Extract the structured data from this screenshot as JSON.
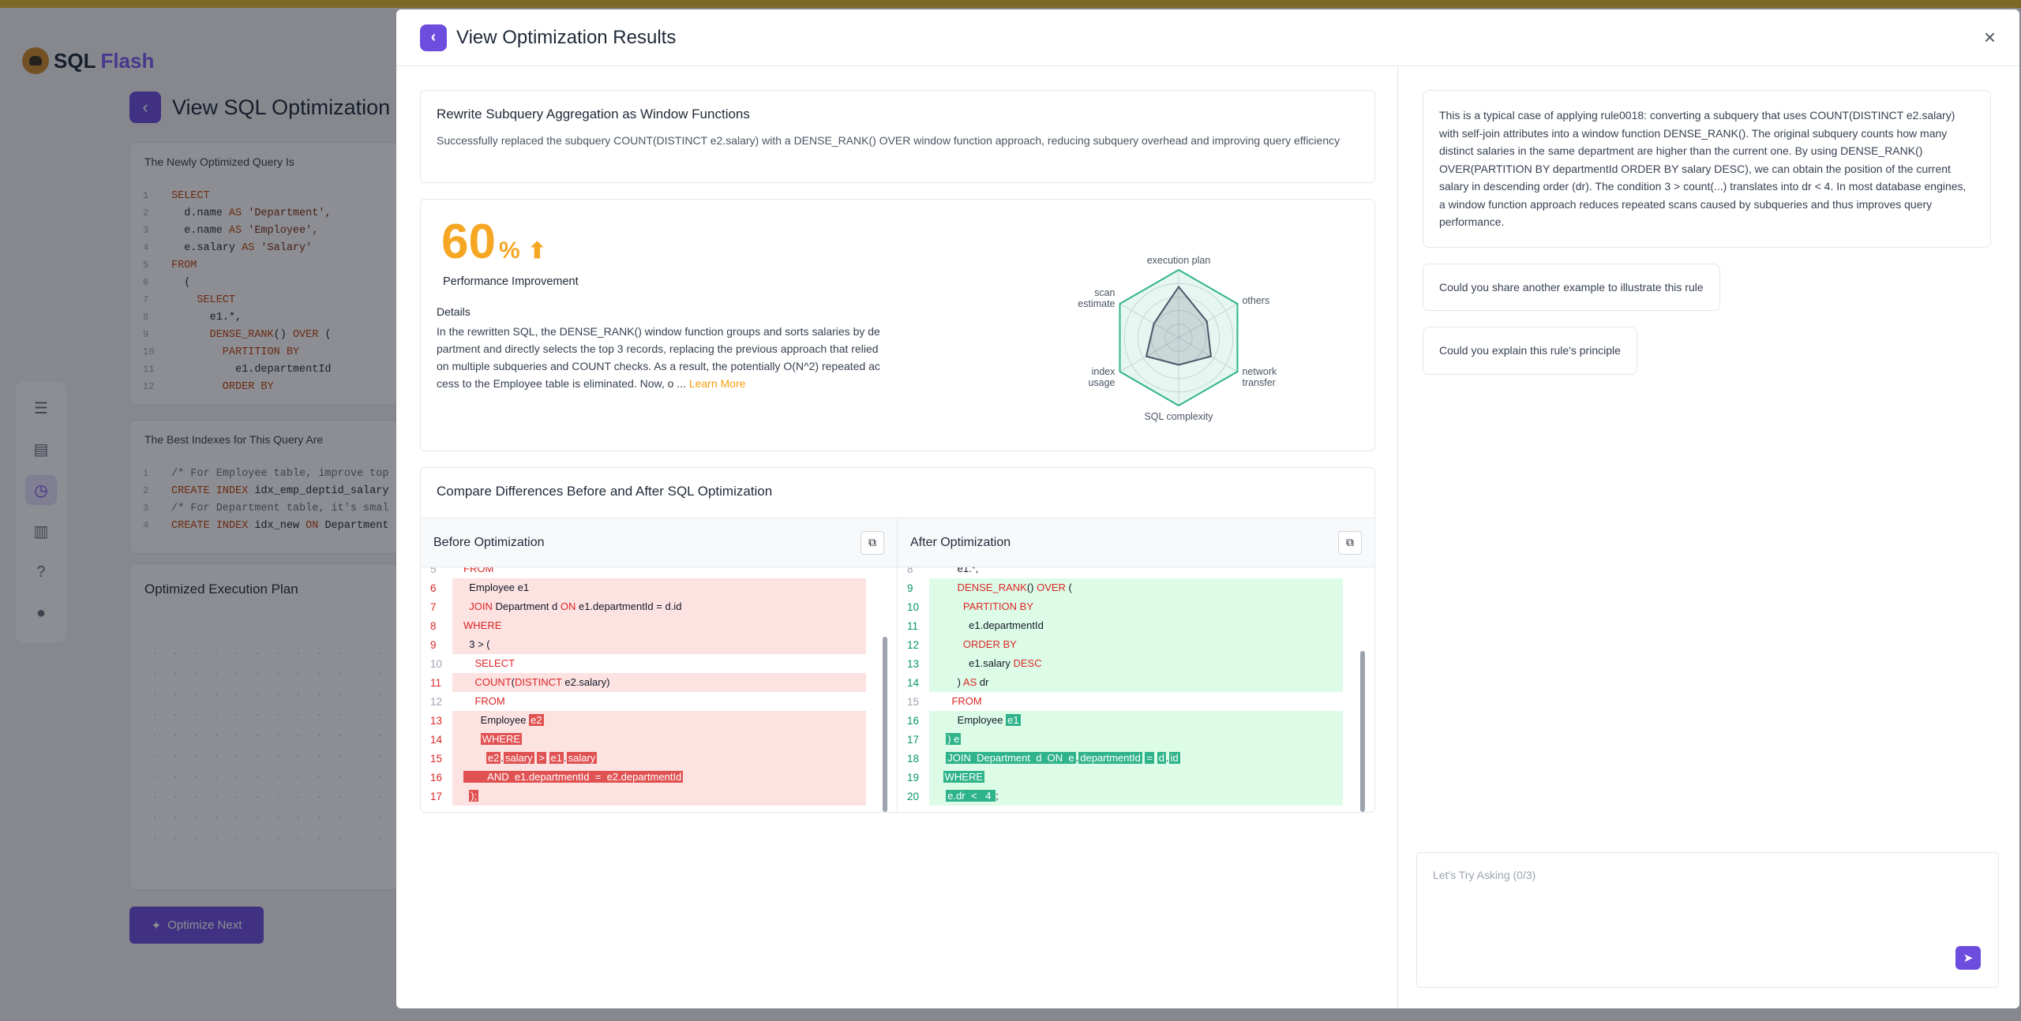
{
  "background": {
    "logo": {
      "sql": "SQL",
      "flash": "Flash"
    },
    "title": "View SQL Optimization Re",
    "optimized_query_title": "The Newly Optimized Query Is",
    "optimized_query_lines": [
      {
        "no": "1",
        "html_parts": [
          {
            "t": "SELECT",
            "c": "kw"
          }
        ]
      },
      {
        "no": "2",
        "html_parts": [
          {
            "t": "  d.name ",
            "c": ""
          },
          {
            "t": "AS",
            "c": "kw"
          },
          {
            "t": " 'Department',",
            "c": "str"
          }
        ]
      },
      {
        "no": "3",
        "html_parts": [
          {
            "t": "  e.name ",
            "c": ""
          },
          {
            "t": "AS",
            "c": "kw"
          },
          {
            "t": " 'Employee',",
            "c": "str"
          }
        ]
      },
      {
        "no": "4",
        "html_parts": [
          {
            "t": "  e.salary ",
            "c": ""
          },
          {
            "t": "AS",
            "c": "kw"
          },
          {
            "t": " 'Salary'",
            "c": "str"
          }
        ]
      },
      {
        "no": "5",
        "html_parts": [
          {
            "t": "FROM",
            "c": "kw"
          }
        ]
      },
      {
        "no": "6",
        "html_parts": [
          {
            "t": "  (",
            "c": ""
          }
        ]
      },
      {
        "no": "7",
        "html_parts": [
          {
            "t": "    SELECT",
            "c": "kw"
          }
        ]
      },
      {
        "no": "8",
        "html_parts": [
          {
            "t": "      e1.*,",
            "c": ""
          }
        ]
      },
      {
        "no": "9",
        "html_parts": [
          {
            "t": "      DENSE_RANK",
            "c": "kw"
          },
          {
            "t": "() ",
            "c": ""
          },
          {
            "t": "OVER",
            "c": "kw"
          },
          {
            "t": " (",
            "c": ""
          }
        ]
      },
      {
        "no": "10",
        "html_parts": [
          {
            "t": "        PARTITION BY",
            "c": "kw"
          }
        ]
      },
      {
        "no": "11",
        "html_parts": [
          {
            "t": "          e1.departmentId",
            "c": ""
          }
        ]
      },
      {
        "no": "12",
        "html_parts": [
          {
            "t": "        ORDER BY",
            "c": "kw"
          }
        ]
      }
    ],
    "indexes_title": "The Best Indexes for This Query Are",
    "index_lines": [
      {
        "no": "1",
        "html_parts": [
          {
            "t": "/* For Employee table, improve top",
            "c": "cm"
          }
        ]
      },
      {
        "no": "2",
        "html_parts": [
          {
            "t": "CREATE INDEX",
            "c": "kw"
          },
          {
            "t": " idx_emp_deptid_salary",
            "c": ""
          }
        ]
      },
      {
        "no": "3",
        "html_parts": [
          {
            "t": "/* For Department table, it's smal",
            "c": "cm"
          }
        ]
      },
      {
        "no": "4",
        "html_parts": [
          {
            "t": "CREATE INDEX",
            "c": "kw"
          },
          {
            "t": " idx_new ",
            "c": ""
          },
          {
            "t": "ON",
            "c": "kw"
          },
          {
            "t": " Department",
            "c": ""
          }
        ]
      }
    ],
    "plan_title": "Optimized Execution Plan",
    "optimize_next_label": "Optimize Next"
  },
  "modal": {
    "title": "View Optimization Results",
    "rule": {
      "title": "Rewrite Subquery Aggregation as Window Functions",
      "description": "Successfully replaced the subquery COUNT(DISTINCT e2.salary) with a DENSE_RANK() OVER window function approach, reducing subquery overhead and improving query efficiency"
    },
    "performance": {
      "value": "60",
      "unit": "%",
      "label": "Performance Improvement",
      "details_title": "Details",
      "details_text": "In the rewritten SQL, the DENSE_RANK() window function groups and sorts salaries by department and directly selects the top 3 records, replacing the previous approach that relied on multiple subqueries and COUNT checks. As a result, the potentially O(N^2) repeated access to the Employee table is eliminated. Now, o ...",
      "learn_more": "Learn More"
    },
    "radar": {
      "axes": [
        "execution plan",
        "others",
        "network transfer",
        "SQL complexity",
        "index usage",
        "scan estimate"
      ],
      "axis_labels": [
        [
          "execution plan"
        ],
        [
          "others"
        ],
        [
          "network",
          "transfer"
        ],
        [
          "SQL complexity"
        ],
        [
          "index",
          "usage"
        ],
        [
          "scan",
          "estimate"
        ]
      ],
      "outer_values": [
        1,
        1,
        1,
        1,
        1,
        1
      ],
      "inner_values": [
        0.75,
        0.48,
        0.55,
        0.4,
        0.55,
        0.42
      ],
      "colors": {
        "outer": "#2fb38a",
        "inner": "#4b5567",
        "grid": "#d1d5db"
      }
    },
    "compare": {
      "title": "Compare Differences Before and After SQL Optimization",
      "before_label": "Before Optimization",
      "after_label": "After Optimization",
      "before_lines": [
        {
          "no": "5",
          "ctx": true,
          "parts": [
            {
              "t": "FROM",
              "c": "rk"
            }
          ]
        },
        {
          "no": "6",
          "parts": [
            {
              "t": "  Employee e1",
              "c": ""
            }
          ]
        },
        {
          "no": "7",
          "parts": [
            {
              "t": "  ",
              "c": ""
            },
            {
              "t": "JOIN",
              "c": "rk"
            },
            {
              "t": " Department d ",
              "c": ""
            },
            {
              "t": "ON",
              "c": "rk"
            },
            {
              "t": " e1.departmentId = d.id",
              "c": ""
            }
          ]
        },
        {
          "no": "8",
          "parts": [
            {
              "t": "WHERE",
              "c": "rk"
            }
          ]
        },
        {
          "no": "9",
          "parts": [
            {
              "t": "  3 > (",
              "c": ""
            }
          ]
        },
        {
          "no": "10",
          "ctx": true,
          "parts": [
            {
              "t": "    SELECT",
              "c": "rk"
            }
          ]
        },
        {
          "no": "11",
          "parts": [
            {
              "t": "    ",
              "c": ""
            },
            {
              "t": "COUNT",
              "c": "rk"
            },
            {
              "t": "(",
              "c": ""
            },
            {
              "t": "DISTINCT",
              "c": "rk"
            },
            {
              "t": " e2.salary)",
              "c": ""
            }
          ]
        },
        {
          "no": "12",
          "ctx": true,
          "parts": [
            {
              "t": "    FROM",
              "c": "rk"
            }
          ]
        },
        {
          "no": "13",
          "parts": [
            {
              "t": "      Employee ",
              "c": ""
            },
            {
              "t": "e2",
              "c": "hlr"
            }
          ]
        },
        {
          "no": "14",
          "parts": [
            {
              "t": "      ",
              "c": ""
            },
            {
              "t": "WHERE",
              "c": "hlr"
            }
          ]
        },
        {
          "no": "15",
          "parts": [
            {
              "t": "        ",
              "c": ""
            },
            {
              "t": "e2",
              "c": "hlr"
            },
            {
              "t": ".",
              "c": ""
            },
            {
              "t": "salary",
              "c": "hlr"
            },
            {
              "t": " ",
              "c": ""
            },
            {
              "t": ">",
              "c": "hlr"
            },
            {
              "t": " ",
              "c": ""
            },
            {
              "t": "e1",
              "c": "hlr"
            },
            {
              "t": ".",
              "c": ""
            },
            {
              "t": "salary",
              "c": "hlr"
            }
          ]
        },
        {
          "no": "16",
          "parts": [
            {
              "t": "        AND  e1.departmentId  =  e2.departmentId",
              "c": "hlr"
            }
          ]
        },
        {
          "no": "17",
          "parts": [
            {
              "t": "  ",
              "c": ""
            },
            {
              "t": ");",
              "c": "hlr"
            }
          ]
        }
      ],
      "after_lines": [
        {
          "no": "8",
          "ctx": true,
          "parts": [
            {
              "t": "      e1.*,",
              "c": ""
            }
          ]
        },
        {
          "no": "9",
          "parts": [
            {
              "t": "      ",
              "c": ""
            },
            {
              "t": "DENSE_RANK",
              "c": "rk"
            },
            {
              "t": "() ",
              "c": ""
            },
            {
              "t": "OVER",
              "c": "rk"
            },
            {
              "t": " (",
              "c": ""
            }
          ]
        },
        {
          "no": "10",
          "parts": [
            {
              "t": "        ",
              "c": ""
            },
            {
              "t": "PARTITION BY",
              "c": "rk"
            }
          ]
        },
        {
          "no": "11",
          "parts": [
            {
              "t": "          e1.departmentId",
              "c": ""
            }
          ]
        },
        {
          "no": "12",
          "parts": [
            {
              "t": "        ",
              "c": ""
            },
            {
              "t": "ORDER BY",
              "c": "rk"
            }
          ]
        },
        {
          "no": "13",
          "parts": [
            {
              "t": "          e1.salary ",
              "c": ""
            },
            {
              "t": "DESC",
              "c": "rk"
            }
          ]
        },
        {
          "no": "14",
          "parts": [
            {
              "t": "      ) ",
              "c": ""
            },
            {
              "t": "AS",
              "c": "rk"
            },
            {
              "t": " dr",
              "c": ""
            }
          ]
        },
        {
          "no": "15",
          "ctx": true,
          "parts": [
            {
              "t": "    ",
              "c": ""
            },
            {
              "t": "FROM",
              "c": "rk"
            }
          ]
        },
        {
          "no": "16",
          "parts": [
            {
              "t": "      Employee ",
              "c": ""
            },
            {
              "t": "e1",
              "c": "hlg"
            }
          ]
        },
        {
          "no": "17",
          "parts": [
            {
              "t": "  ",
              "c": ""
            },
            {
              "t": ") e",
              "c": "hlg"
            }
          ]
        },
        {
          "no": "18",
          "parts": [
            {
              "t": "  ",
              "c": ""
            },
            {
              "t": "JOIN  Department  d  ON  e",
              "c": "hlg"
            },
            {
              "t": ".",
              "c": ""
            },
            {
              "t": "departmentId",
              "c": "hlg"
            },
            {
              "t": " ",
              "c": ""
            },
            {
              "t": "=",
              "c": "hlg"
            },
            {
              "t": " ",
              "c": ""
            },
            {
              "t": "d",
              "c": "hlg"
            },
            {
              "t": ".",
              "c": ""
            },
            {
              "t": "id",
              "c": "hlg"
            }
          ]
        },
        {
          "no": "19",
          "parts": [
            {
              "t": " ",
              "c": ""
            },
            {
              "t": "WHERE",
              "c": "hlg"
            }
          ]
        },
        {
          "no": "20",
          "parts": [
            {
              "t": "  ",
              "c": ""
            },
            {
              "t": "e.dr  <   4 ",
              "c": "hlg"
            },
            {
              "t": ";",
              "c": ""
            }
          ]
        }
      ]
    },
    "chat": {
      "answer": "This is a typical case of applying rule0018: converting a subquery that uses COUNT(DISTINCT e2.salary) with self-join attributes into a window function DENSE_RANK(). The original subquery counts how many distinct salaries in the same department are higher than the current one. By using DENSE_RANK() OVER(PARTITION BY departmentId ORDER BY salary DESC), we can obtain the position of the current salary in descending order (dr). The condition 3 > count(...) translates into dr < 4. In most database engines, a window function approach reduces repeated scans caused by subqueries and thus improves query performance.",
      "suggestions": [
        "Could you share another example to illustrate this rule",
        "Could you explain this rule's principle"
      ],
      "input_placeholder": "Let's Try Asking (0/3)"
    }
  }
}
